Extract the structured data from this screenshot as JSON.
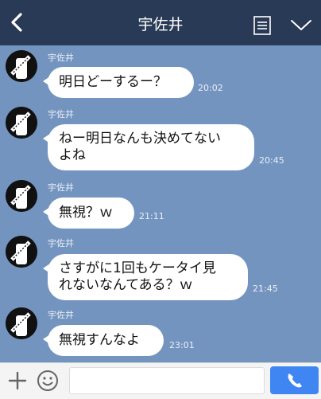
{
  "header": {
    "title": "宇佐井",
    "back_icon": "chevron-left-icon",
    "notes_icon": "notes-icon",
    "menu_icon": "chevron-down-icon"
  },
  "messages": [
    {
      "sender": "宇佐井",
      "lines": [
        "明日どーするー？"
      ],
      "time": "20:02"
    },
    {
      "sender": "宇佐井",
      "lines": [
        "ねー明日なんも決めてない",
        "よね"
      ],
      "time": "20:45"
    },
    {
      "sender": "宇佐井",
      "lines": [
        "無視？ｗ"
      ],
      "time": "21:11"
    },
    {
      "sender": "宇佐井",
      "lines": [
        "さすがに1回もケータイ見",
        "れないなんてある？ｗ"
      ],
      "time": "21:45"
    },
    {
      "sender": "宇佐井",
      "lines": [
        "無視すんなよ"
      ],
      "time": "23:01"
    }
  ],
  "footer": {
    "input_placeholder": "",
    "plus_icon": "plus-icon",
    "emoji_icon": "smiley-icon",
    "call_icon": "phone-icon"
  },
  "colors": {
    "header_bg": "#283a55",
    "chat_bg": "#7494c0",
    "bubble_bg": "#ffffff",
    "call_button": "#3f86f2"
  }
}
